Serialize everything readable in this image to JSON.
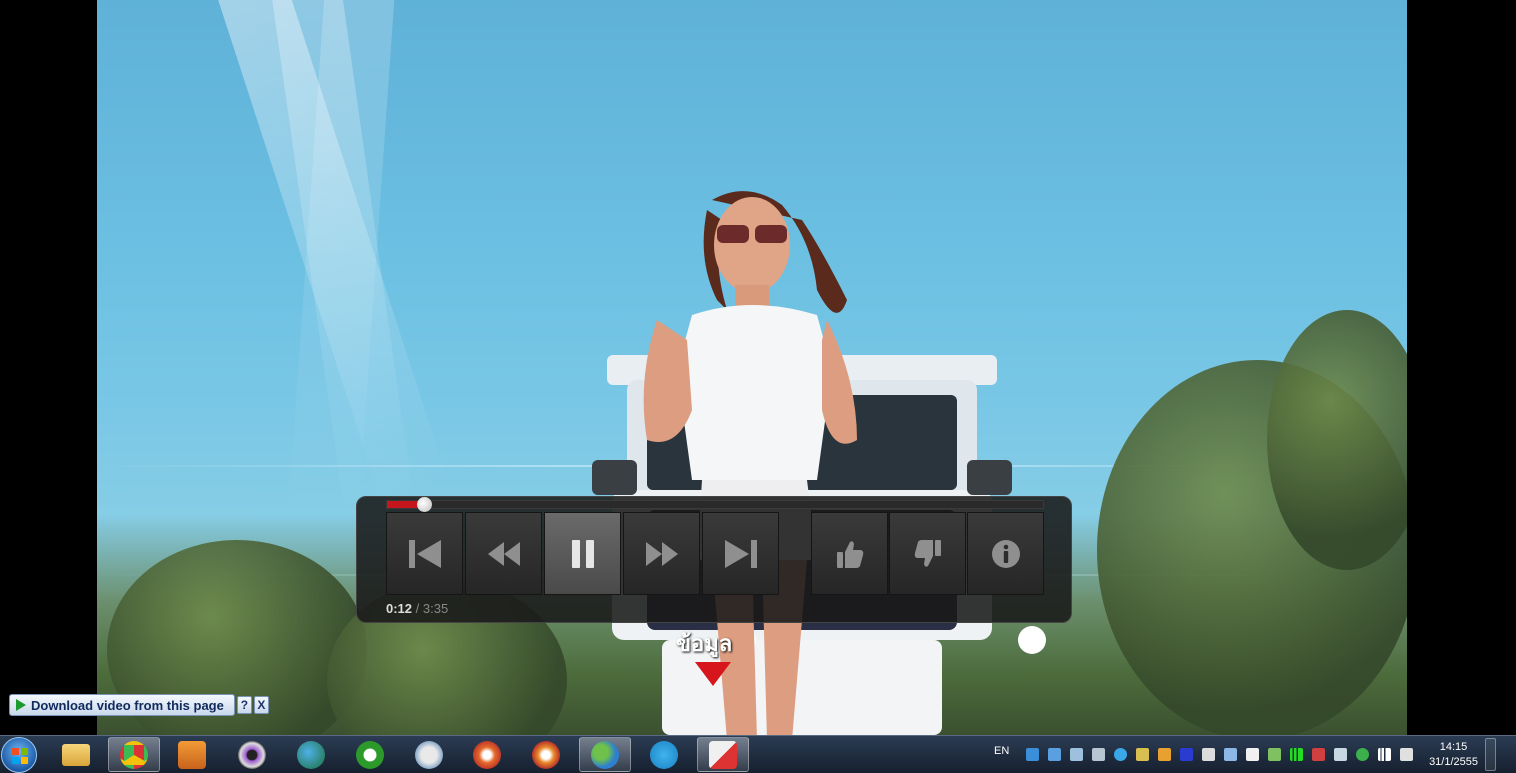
{
  "player": {
    "progress": 0.056,
    "time_current": "0:12",
    "time_separator": " / ",
    "time_total": "3:35",
    "buttons": [
      {
        "name": "previous-button",
        "icon": "skip-previous-icon"
      },
      {
        "name": "rewind-button",
        "icon": "rewind-icon"
      },
      {
        "name": "pause-button",
        "icon": "pause-icon",
        "active": true
      },
      {
        "name": "fast-forward-button",
        "icon": "fast-forward-icon"
      },
      {
        "name": "next-button",
        "icon": "skip-next-icon"
      },
      {
        "name": "like-button",
        "icon": "thumbs-up-icon"
      },
      {
        "name": "dislike-button",
        "icon": "thumbs-down-icon"
      },
      {
        "name": "info-button",
        "icon": "info-icon"
      }
    ],
    "tooltip": "ข้อมูล",
    "accent_color": "#c4161c"
  },
  "download_bar": {
    "label": "Download video from this page",
    "help": "?",
    "close": "X"
  },
  "taskbar": {
    "language": "EN",
    "clock_time": "14:15",
    "clock_date": "31/1/2555",
    "apps": [
      {
        "icon": "folder-icon"
      },
      {
        "icon": "chrome-icon",
        "active": true
      },
      {
        "icon": "media-player-icon"
      },
      {
        "icon": "eye-icon"
      },
      {
        "icon": "download-manager-icon"
      },
      {
        "icon": "utorrent-icon"
      },
      {
        "icon": "label-print-icon"
      },
      {
        "icon": "disc-icon"
      },
      {
        "icon": "disc-icon-2"
      },
      {
        "icon": "messenger-icon",
        "active": true
      },
      {
        "icon": "twitter-icon"
      },
      {
        "icon": "snipping-tool-icon",
        "active": true
      }
    ]
  }
}
